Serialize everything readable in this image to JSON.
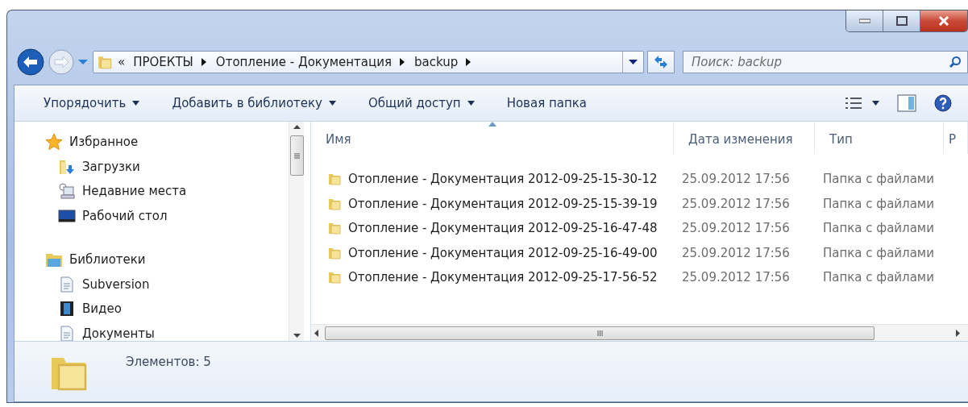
{
  "address_bar": {
    "overflow": "«",
    "segments": [
      "ПРОЕКТЫ",
      "Отопление - Документация",
      "backup"
    ]
  },
  "search": {
    "placeholder": "Поиск: backup"
  },
  "toolbar": {
    "items": [
      {
        "label": "Упорядочить",
        "dropdown": true
      },
      {
        "label": "Добавить в библиотеку",
        "dropdown": true
      },
      {
        "label": "Общий доступ",
        "dropdown": true
      },
      {
        "label": "Новая папка",
        "dropdown": false
      }
    ]
  },
  "sidebar": {
    "groups": [
      {
        "label": "Избранное",
        "kind": "favorites",
        "items": [
          {
            "label": "Загрузки",
            "kind": "downloads"
          },
          {
            "label": "Недавние места",
            "kind": "recent"
          },
          {
            "label": "Рабочий стол",
            "kind": "desktop"
          }
        ]
      },
      {
        "label": "Библиотеки",
        "kind": "libraries",
        "items": [
          {
            "label": "Subversion",
            "kind": "document"
          },
          {
            "label": "Видео",
            "kind": "video"
          },
          {
            "label": "Документы",
            "kind": "document"
          }
        ]
      }
    ]
  },
  "table": {
    "columns": [
      {
        "label": "Имя",
        "sorted": true
      },
      {
        "label": "Дата изменения",
        "sorted": false
      },
      {
        "label": "Тип",
        "sorted": false
      },
      {
        "label": "Р",
        "sorted": false
      }
    ],
    "rows": [
      {
        "name": "Отопление - Документация 2012-09-25-15-30-12",
        "date": "25.09.2012 17:56",
        "type": "Папка с файлами"
      },
      {
        "name": "Отопление - Документация 2012-09-25-15-39-19",
        "date": "25.09.2012 17:56",
        "type": "Папка с файлами"
      },
      {
        "name": "Отопление - Документация 2012-09-25-16-47-48",
        "date": "25.09.2012 17:56",
        "type": "Папка с файлами"
      },
      {
        "name": "Отопление - Документация 2012-09-25-16-49-00",
        "date": "25.09.2012 17:56",
        "type": "Папка с файлами"
      },
      {
        "name": "Отопление - Документация 2012-09-25-17-56-52",
        "date": "25.09.2012 17:56",
        "type": "Папка с файлами"
      }
    ]
  },
  "status_bar": {
    "count": "Элементов: 5"
  }
}
